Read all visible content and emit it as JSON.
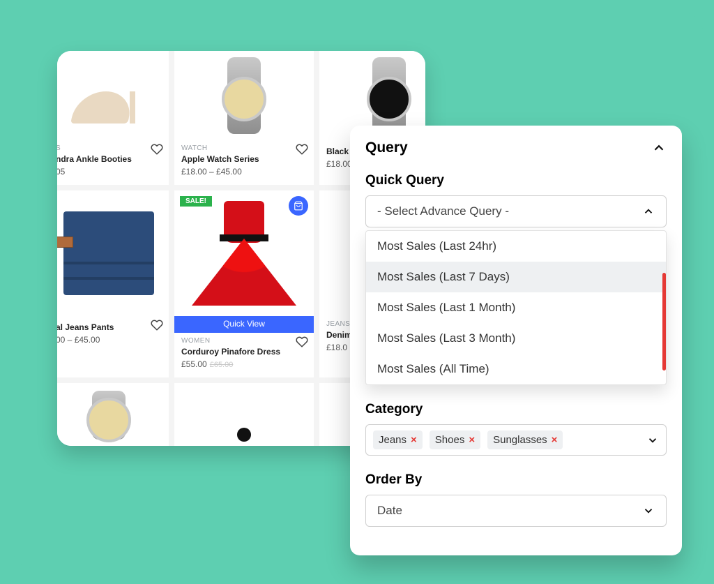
{
  "products": [
    {
      "cat": "S",
      "title": "ndra Ankle Booties",
      "price": "05"
    },
    {
      "cat": "WATCH",
      "title": "Apple Watch Series",
      "price": "£18.00 – £45.00"
    },
    {
      "cat": "",
      "title": "Black D",
      "price": "£18.00"
    },
    {
      "cat": "",
      "title": "al Jeans Pants",
      "price": "00 – £45.00"
    },
    {
      "cat": "WOMEN",
      "title": "Corduroy Pinafore Dress",
      "price": "£55.00",
      "old": "£65.00",
      "sale": "SALE!",
      "qv": "Quick View"
    },
    {
      "cat": "JEANS",
      "title": "Denim J",
      "price": "£18.0"
    }
  ],
  "query": {
    "title": "Query",
    "quick_label": "Quick Query",
    "select_placeholder": "- Select Advance Query -",
    "options": [
      "Most Sales (Last 24hr)",
      "Most Sales (Last 7 Days)",
      "Most Sales (Last 1 Month)",
      "Most Sales (Last 3 Month)",
      "Most Sales (All Time)"
    ],
    "selected_index": 1,
    "category_label": "Category",
    "category_chips": [
      "Jeans",
      "Shoes",
      "Sunglasses"
    ],
    "orderby_label": "Order By",
    "orderby_value": "Date"
  }
}
